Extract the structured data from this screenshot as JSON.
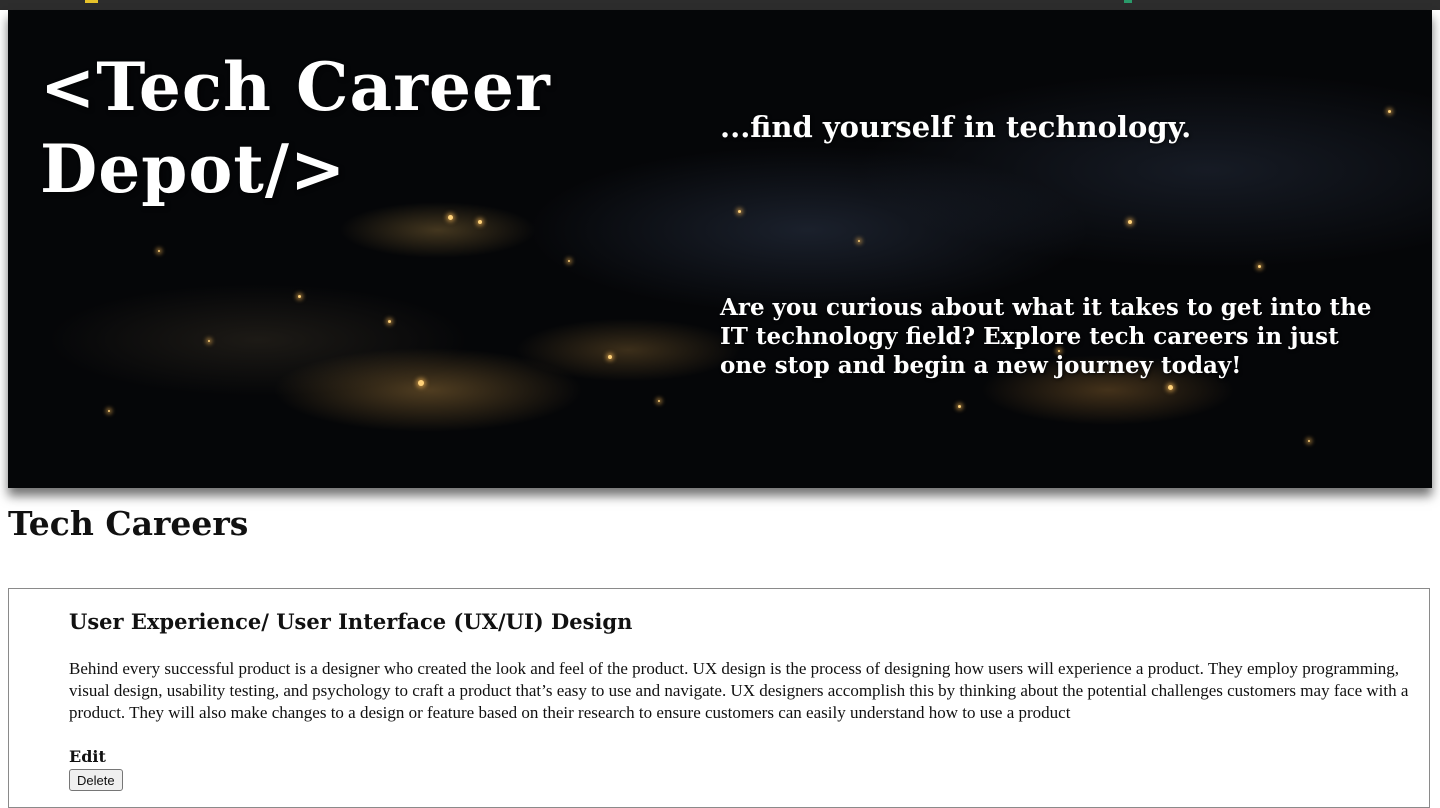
{
  "hero": {
    "title_line1": "<Tech Career",
    "title_line2": "Depot/>",
    "tagline": "...find yourself in technology.",
    "intro": "Are you curious about what it takes to get into the IT technology field? Explore tech careers in just one stop and begin a new journey today!"
  },
  "careers_section": {
    "heading": "Tech Careers",
    "items": [
      {
        "title": "User Experience/ User Interface (UX/UI) Design",
        "description": "Behind every successful product is a designer who created the look and feel of the product. UX design is the process of designing how users will experience a product. They employ programming, visual design, usability testing, and psychology to craft a product that’s easy to use and navigate. UX designers accomplish this by thinking about the potential challenges customers may face with a product. They will also make changes to a design or feature based on their research to ensure customers can easily understand how to use a product",
        "edit_label": "Edit",
        "delete_label": "Delete"
      }
    ]
  },
  "colors": {
    "topbar": "#2d2d2d",
    "hero_text": "#ffffff",
    "body_text": "#111111",
    "card_border": "#8a8a8a"
  }
}
